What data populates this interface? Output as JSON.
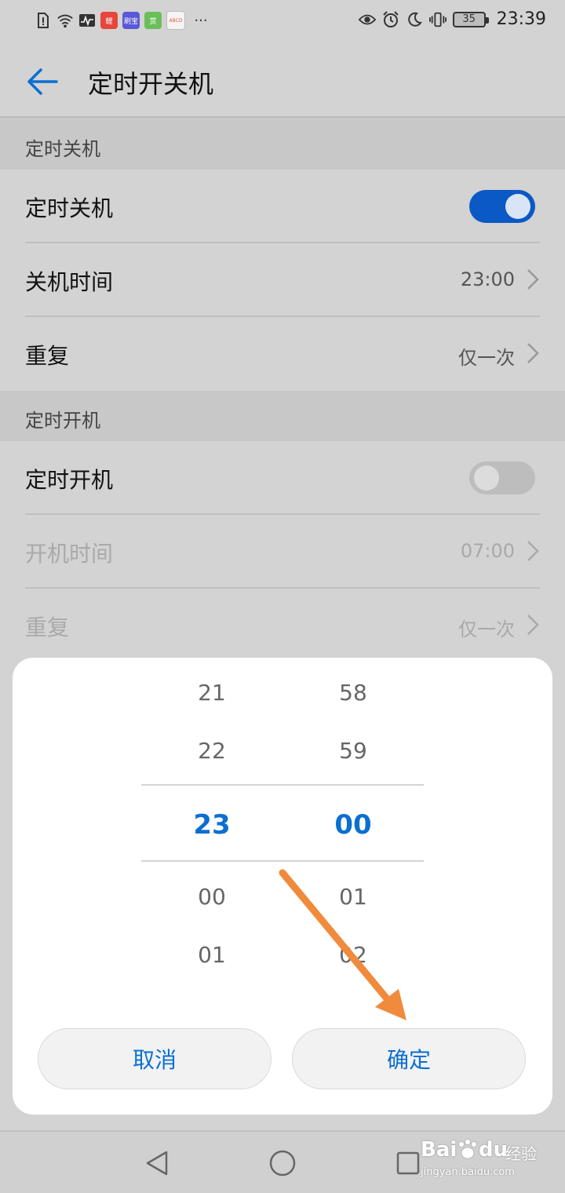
{
  "status_bar": {
    "app_badges": [
      "鲤",
      "刷宝",
      "赏",
      "ABCD"
    ],
    "battery": "35",
    "time": "23:39",
    "more": "···"
  },
  "header": {
    "title": "定时开关机"
  },
  "shutdown_section": {
    "header": "定时关机",
    "toggle_label": "定时关机",
    "toggle_state": "on",
    "time_label": "关机时间",
    "time_value": "23:00",
    "repeat_label": "重复",
    "repeat_value": "仅一次"
  },
  "boot_section": {
    "header": "定时开机",
    "toggle_label": "定时开机",
    "toggle_state": "off",
    "time_label": "开机时间",
    "time_value": "07:00",
    "repeat_label": "重复",
    "repeat_value": "仅一次"
  },
  "time_picker": {
    "hours": [
      "21",
      "22",
      "23",
      "00",
      "01"
    ],
    "minutes": [
      "58",
      "59",
      "00",
      "01",
      "02"
    ],
    "selected_hour": "23",
    "selected_minute": "00",
    "cancel_label": "取消",
    "confirm_label": "确定",
    "accent_color": "#0a6fd1"
  },
  "annotation": {
    "arrow_color": "#f08a3c"
  },
  "watermark": {
    "brand": "Bai",
    "brand2": "du",
    "suffix": "经验",
    "url": "jingyan.baidu.com"
  }
}
